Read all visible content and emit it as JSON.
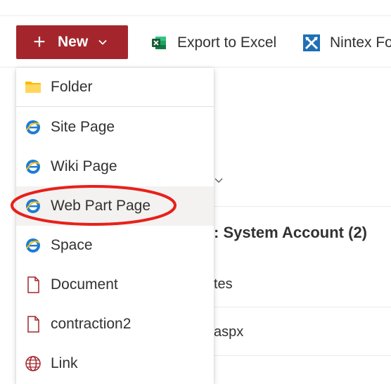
{
  "toolbar": {
    "new_label": "New",
    "export_label": "Export to Excel",
    "nintex_label": "Nintex Fo"
  },
  "background": {
    "group_header": ": System Account (2)",
    "row1": "tes",
    "row2": "aspx"
  },
  "menu": {
    "items": [
      {
        "label": "Folder",
        "icon": "folder-icon"
      },
      {
        "label": "Site Page",
        "icon": "ie-page-icon"
      },
      {
        "label": "Wiki Page",
        "icon": "ie-page-icon"
      },
      {
        "label": "Web Part Page",
        "icon": "ie-page-icon"
      },
      {
        "label": "Space",
        "icon": "ie-page-icon"
      },
      {
        "label": "Document",
        "icon": "document-icon"
      },
      {
        "label": "contraction2",
        "icon": "document-icon"
      },
      {
        "label": "Link",
        "icon": "globe-icon"
      }
    ]
  },
  "colors": {
    "new_button": "#a4262c",
    "highlight_ring": "#e8201a",
    "excel": "#217346",
    "nintex": "#1f6fb5"
  }
}
